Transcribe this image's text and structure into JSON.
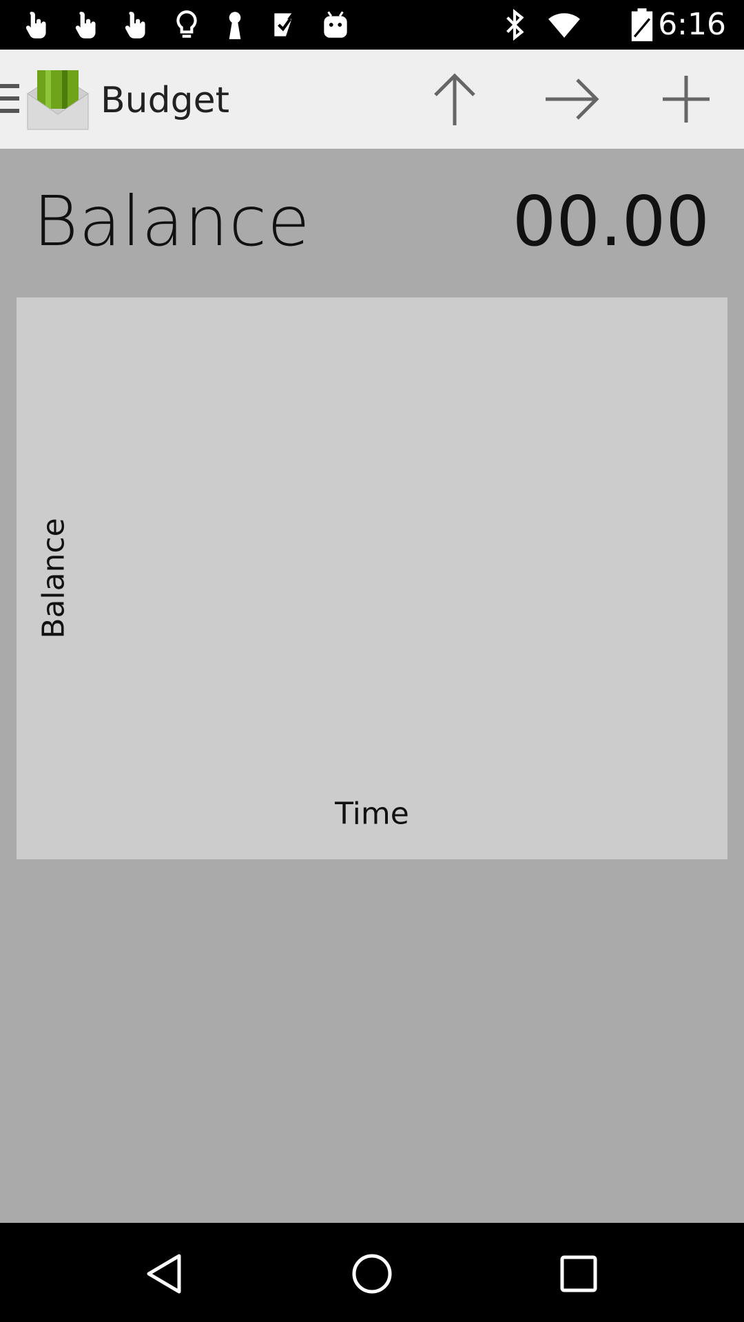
{
  "status_bar": {
    "time": "6:16",
    "icons": [
      "touch-icon",
      "touch-icon",
      "touch-icon",
      "lightbulb-icon",
      "keyhole-icon",
      "task-check-icon",
      "android-icon",
      "bluetooth-icon",
      "wifi-icon",
      "battery-icon"
    ]
  },
  "action_bar": {
    "title": "Budget",
    "actions": [
      "arrow-up-icon",
      "arrow-forward-icon",
      "add-icon"
    ],
    "logo_colors": {
      "envelope": "#cfcfcf",
      "card": "#6ea31a"
    }
  },
  "balance": {
    "label": "Balance",
    "value": "00.00"
  },
  "chart": {
    "ylabel": "Balance",
    "xlabel": "Time"
  },
  "colors": {
    "background": "#aaaaaa",
    "panel": "#cccccc",
    "action_bar": "#efefef"
  }
}
